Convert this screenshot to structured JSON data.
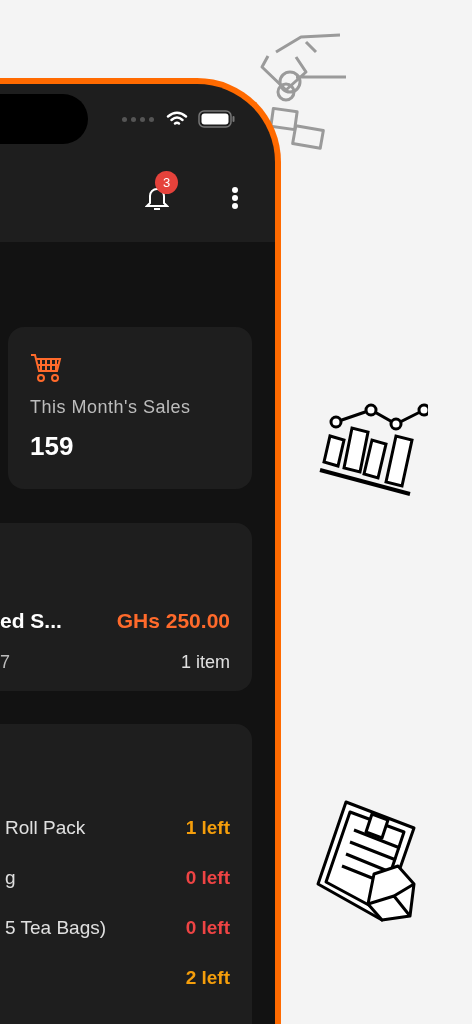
{
  "app_bar": {
    "notification_count": "3"
  },
  "stats_card": {
    "label": "This Month's Sales",
    "value": "159"
  },
  "recent_sale": {
    "title": "ed S...",
    "subtitle": "7",
    "amount": "GHs 250.00",
    "items": "1 item"
  },
  "low_stock": [
    {
      "name": "Roll Pack",
      "stock": "1 left",
      "color": "#f59e0b"
    },
    {
      "name": "g",
      "stock": "0 left",
      "color": "#ef4444"
    },
    {
      "name": "5 Tea Bags)",
      "stock": "0 left",
      "color": "#ef4444"
    },
    {
      "stock": "2 left",
      "color": "#f59e0b"
    }
  ]
}
